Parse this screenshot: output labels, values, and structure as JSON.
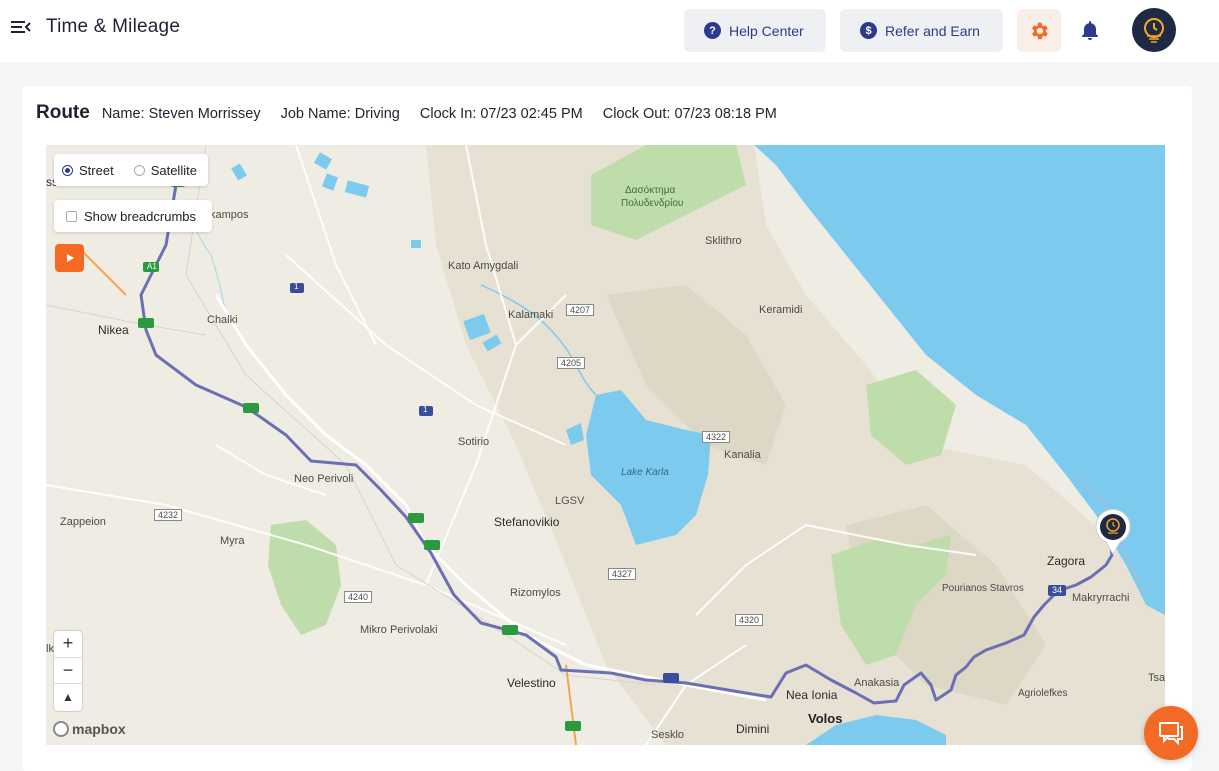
{
  "header": {
    "title": "Time & Mileage",
    "help_label": "Help Center",
    "refer_label": "Refer and Earn",
    "help_icon": "question-circle-icon",
    "refer_icon": "dollar-circle-icon",
    "settings_icon": "gear-icon",
    "notifications_icon": "bell-icon"
  },
  "route": {
    "title": "Route",
    "name_label": "Name:",
    "name_value": "Steven Morrissey",
    "job_label": "Job Name:",
    "job_value": "Driving",
    "clock_in_label": "Clock In:",
    "clock_in_value": "07/23 02:45 PM",
    "clock_out_label": "Clock Out:",
    "clock_out_value": "07/23 08:18 PM"
  },
  "map": {
    "layer_street": "Street",
    "layer_satellite": "Satellite",
    "selected_layer": "Street",
    "breadcrumbs_label": "Show breadcrumbs",
    "breadcrumbs_checked": false,
    "zoom_in": "+",
    "zoom_out": "−",
    "compass": "▲",
    "attribution": "mapbox",
    "labels": {
      "ssa": "ssa",
      "kampos": "kampos",
      "nikea": "Nikea",
      "chalki": "Chalki",
      "kato_amygdali": "Kato Amygdali",
      "kalamaki": "Kalamaki",
      "forest_1": "Δασόκτημα",
      "forest_2": "Πολυδενδρίου",
      "sklithro": "Sklithro",
      "keramidi": "Keramidi",
      "sotirio": "Sotirio",
      "neo_perivoli": "Neo Perivoli",
      "lake_karla": "Lake Karla",
      "lgsv": "LGSV",
      "kanalia": "Kanalia",
      "zappeion": "Zappeion",
      "myra": "Myra",
      "stefanovikio": "Stefanovikio",
      "rizomylos": "Rizomylos",
      "mikro_perivolaki": "Mikro Perivolaki",
      "velestino": "Velestino",
      "nea_ionia": "Nea Ionia",
      "volos": "Volos",
      "dimini": "Dimini",
      "sesklo": "Sesklo",
      "anakasia": "Anakasia",
      "zagora": "Zagora",
      "pourianos_stavros": "Pourianos Stavros",
      "makryrrachi": "Makryrrachi",
      "agriolefkes": "Agriolefkes",
      "tsa": "Tsa",
      "lk": "lk",
      "r4207": "4207",
      "r4205": "4205",
      "r4322": "4322",
      "r4232": "4232",
      "r4327": "4327",
      "r4240": "4240",
      "r4320": "4320",
      "r34": "34",
      "r1a": "1",
      "r1b": "1",
      "a1": "A1"
    }
  },
  "colors": {
    "primary": "#2d3a8c",
    "accent": "#f26a24",
    "route_line": "#6b6fb4",
    "water": "#7ccbee",
    "forest": "#bfdcab"
  }
}
